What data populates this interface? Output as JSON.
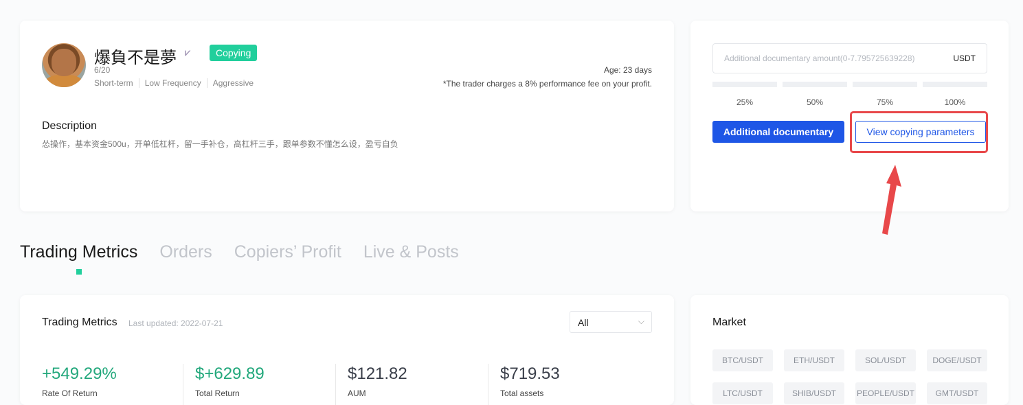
{
  "trader": {
    "name": "爆負不是夢",
    "status": "Copying",
    "followers": "6/20",
    "tags": [
      "Short-term",
      "Low Frequency",
      "Aggressive"
    ],
    "age": "Age: 23 days",
    "fee_note": "*The trader charges a 8% performance fee on your profit.",
    "description_title": "Description",
    "description": "怂操作，基本资金500u，开单低杠杆，留一手补仓，高杠杆三手，跟单参数不懂怎么设，盈亏自负"
  },
  "copy_panel": {
    "amount_placeholder": "Additional documentary amount(0-7.795725639228)",
    "unit": "USDT",
    "percent_options": [
      "25%",
      "50%",
      "75%",
      "100%"
    ],
    "primary_button": "Additional documentary",
    "secondary_button": "View copying parameters"
  },
  "tabs": [
    "Trading Metrics",
    "Orders",
    "Copiers’ Profit",
    "Live & Posts"
  ],
  "metrics": {
    "title": "Trading Metrics",
    "updated": "Last updated: 2022-07-21",
    "filter": "All",
    "stats": [
      {
        "value": "+549.29%",
        "label": "Rate Of Return"
      },
      {
        "value": "$+629.89",
        "label": "Total Return"
      },
      {
        "value": "$121.82",
        "label": "AUM"
      },
      {
        "value": "$719.53",
        "label": "Total assets"
      }
    ]
  },
  "market": {
    "title": "Market",
    "pairs": [
      "BTC/USDT",
      "ETH/USDT",
      "SOL/USDT",
      "DOGE/USDT",
      "LTC/USDT",
      "SHIB/USDT",
      "PEOPLE/USDT",
      "GMT/USDT"
    ]
  },
  "colors": {
    "accent_green": "#21cf9c",
    "primary_blue": "#1e56e6",
    "annotation_red": "#e8484a"
  }
}
